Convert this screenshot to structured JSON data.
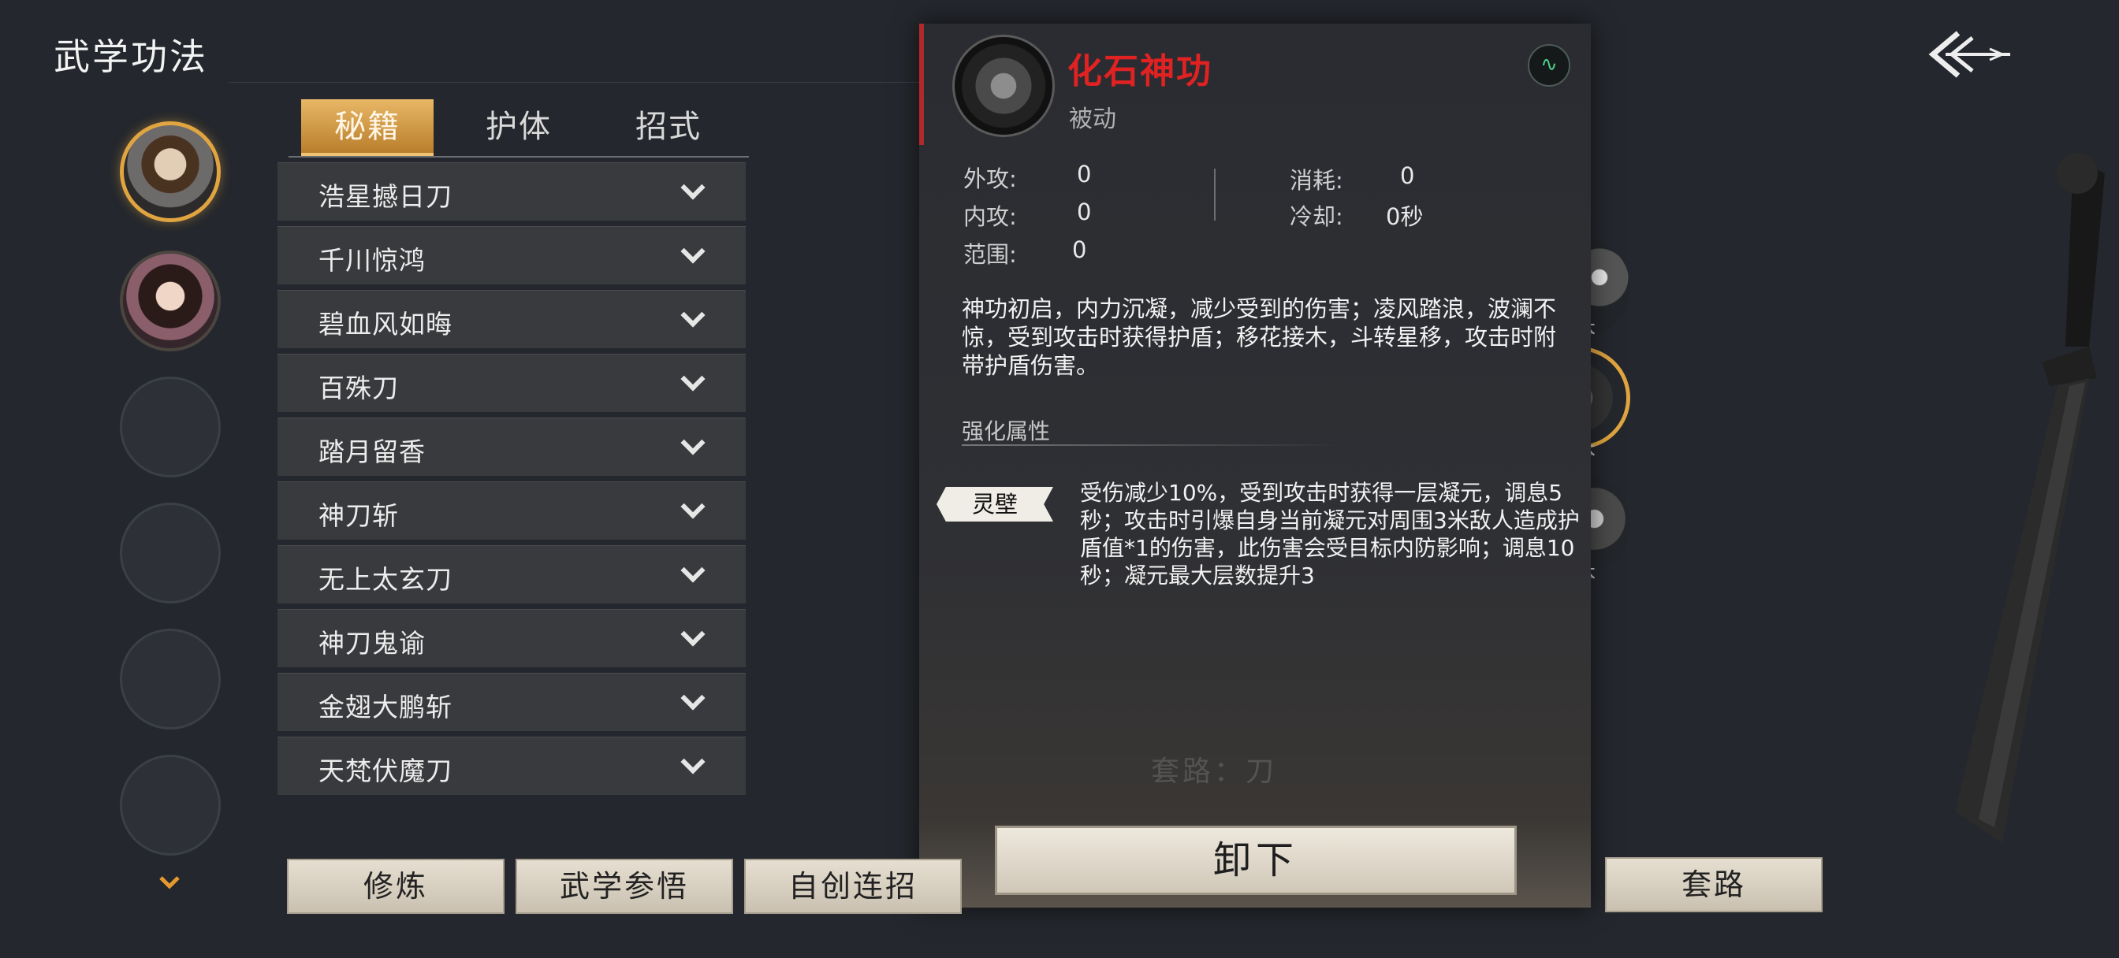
{
  "page_title": "武学功法",
  "tabs": [
    {
      "label": "秘籍",
      "active": true
    },
    {
      "label": "护体",
      "active": false
    },
    {
      "label": "招式",
      "active": false
    }
  ],
  "skill_list": [
    "浩星撼日刀",
    "千川惊鸿",
    "碧血风如晦",
    "百殊刀",
    "踏月留香",
    "神刀斩",
    "无上太玄刀",
    "神刀鬼谕",
    "金翅大鹏斩",
    "天梵伏魔刀"
  ],
  "bottom_buttons": {
    "cultivate": "修炼",
    "comprehend": "武学参悟",
    "custom_combo": "自创连招",
    "unload": "卸下",
    "route": "套路"
  },
  "detail": {
    "name": "化石神功",
    "type": "被动",
    "stats": {
      "outer_attack_label": "外攻:",
      "outer_attack_value": "0",
      "inner_attack_label": "内攻:",
      "inner_attack_value": "0",
      "range_label": "范围:",
      "range_value": "0",
      "cost_label": "消耗:",
      "cost_value": "0",
      "cooldown_label": "冷却:",
      "cooldown_value": "0秒"
    },
    "description": "神功初启，内力沉凝，减少受到的伤害；凌风踏浪，波澜不惊，受到攻击时获得护盾；移花接木，斗转星移，攻击时附带护盾伤害。",
    "enhance_title": "强化属性",
    "enhance_tag": "灵壁",
    "enhance_desc": "受伤减少10%，受到攻击时获得一层凝元，调息5秒；攻击时引爆自身当前凝元对周围3米敌人造成护盾值*1的伤害，此伤害会受目标内防影响；调息10秒；凝元最大层数提升3",
    "faint_route": "套路：刀"
  },
  "side_labels": [
    "本",
    "本",
    "本"
  ],
  "colors": {
    "accent_gold": "#e0a540",
    "skill_name_red": "#e02222",
    "panel_bg": "#2c2e33"
  }
}
